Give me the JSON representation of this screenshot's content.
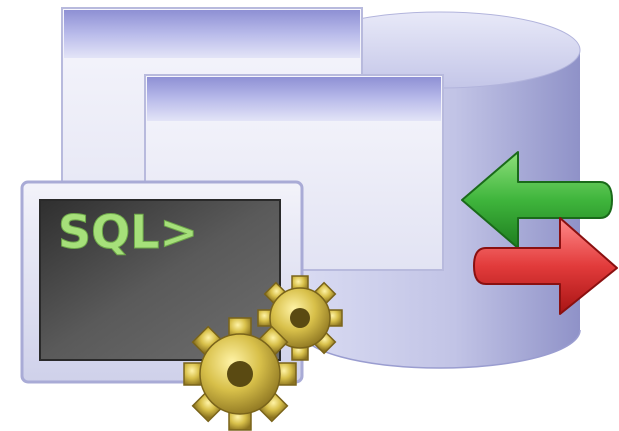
{
  "terminal": {
    "prompt": "SQL>"
  },
  "colors": {
    "database": "#c9cbe8",
    "window_frame": "#f4f4fb",
    "window_titlebar": "#a7a9de",
    "terminal_screen": "#4e4e4e",
    "prompt_text": "#a6e07a",
    "gear": "#d8c04a",
    "arrow_left": "#3fb53c",
    "arrow_right": "#e23b3b"
  },
  "icons": {
    "database": "database-cylinder-icon",
    "windows": "window-icon",
    "terminal": "terminal-icon",
    "gears": "gear-icon",
    "arrow_left": "arrow-left-icon",
    "arrow_right": "arrow-right-icon"
  }
}
